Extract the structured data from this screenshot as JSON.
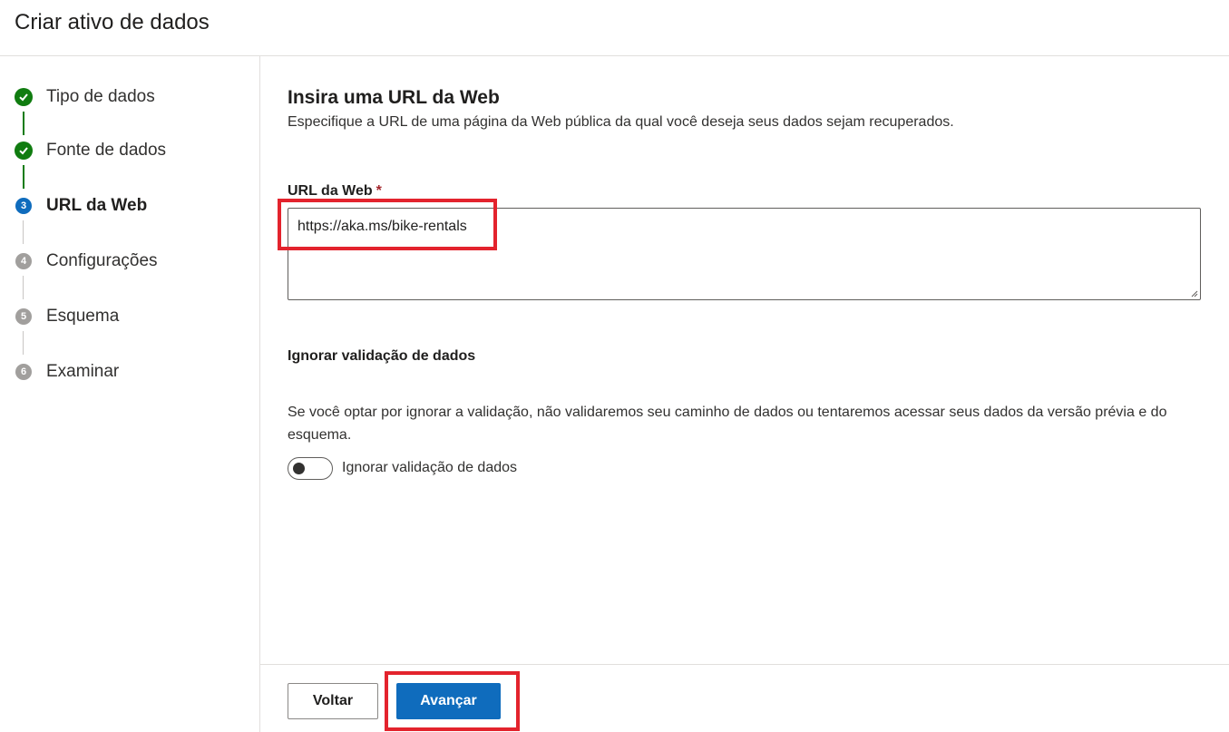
{
  "header": {
    "title": "Criar ativo de dados"
  },
  "steps": [
    {
      "number": "1",
      "label": "Tipo de dados",
      "state": "done"
    },
    {
      "number": "2",
      "label": "Fonte de dados",
      "state": "done"
    },
    {
      "number": "3",
      "label": "URL da Web",
      "state": "active"
    },
    {
      "number": "4",
      "label": "Configurações",
      "state": "pending"
    },
    {
      "number": "5",
      "label": "Esquema",
      "state": "pending"
    },
    {
      "number": "6",
      "label": "Examinar",
      "state": "pending"
    }
  ],
  "main": {
    "title": "Insira uma URL da Web",
    "description": "Especifique a URL de uma página da Web pública da qual você deseja seus dados sejam recuperados.",
    "url_field": {
      "label": "URL da Web",
      "required_mark": "*",
      "value": "https://aka.ms/bike-rentals"
    },
    "ignore_validation": {
      "title": "Ignorar validação de dados",
      "description": "Se você optar por ignorar a validação, não validaremos seu caminho de dados ou tentaremos acessar seus dados da versão prévia e do esquema.",
      "toggle_label": "Ignorar validação de dados",
      "toggle_on": false
    }
  },
  "footer": {
    "back_label": "Voltar",
    "next_label": "Avançar"
  },
  "colors": {
    "done": "#107c10",
    "active": "#0f6cbd",
    "pending": "#a19f9d",
    "highlight": "#e3232d"
  }
}
